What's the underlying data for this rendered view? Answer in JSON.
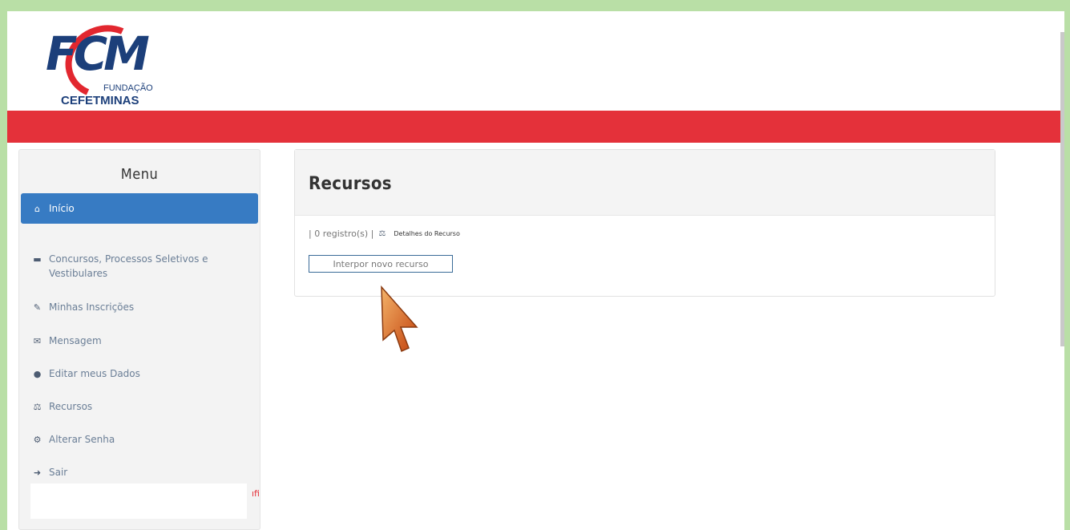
{
  "brand": {
    "logo_text": "FCM",
    "logo_sub1": "FUNDAÇÃO",
    "logo_sub2": "CEFETMINAS",
    "primary_color": "#1c3f7a",
    "accent_color": "#e4313a"
  },
  "sidebar": {
    "title": "Menu",
    "items": [
      {
        "label": "Início",
        "icon": "home-icon",
        "active": true
      },
      {
        "label": "Concursos, Processos Seletivos e Vestibulares",
        "icon": "folder-icon"
      },
      {
        "label": "Minhas Inscrições",
        "icon": "edit-icon"
      },
      {
        "label": "Mensagem",
        "icon": "envelope-icon"
      },
      {
        "label": "Editar meus Dados",
        "icon": "user-icon"
      },
      {
        "label": "Recursos",
        "icon": "scale-icon"
      },
      {
        "label": "Alterar Senha",
        "icon": "gear-icon"
      },
      {
        "label": "Sair",
        "icon": "sign-out-icon"
      }
    ],
    "notice_fragment": "ıfi"
  },
  "panel": {
    "title": "Recursos",
    "records": "| 0 registro(s) |",
    "detail_link": "Detalhes do Recurso",
    "new_button": "Interpor novo recurso"
  }
}
